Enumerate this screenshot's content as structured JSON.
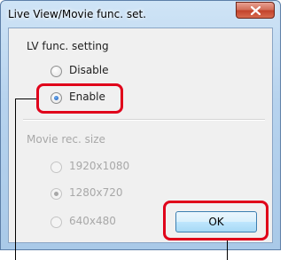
{
  "dialog": {
    "title": "Live View/Movie func. set.",
    "close_icon": "close-icon"
  },
  "lv_group": {
    "heading": "LV func. setting",
    "options": [
      {
        "label": "Disable",
        "selected": false,
        "enabled": true
      },
      {
        "label": "Enable",
        "selected": true,
        "enabled": true
      }
    ]
  },
  "movie_group": {
    "heading": "Movie rec. size",
    "enabled": false,
    "options": [
      {
        "label": "1920x1080",
        "selected": false
      },
      {
        "label": "1280x720",
        "selected": true
      },
      {
        "label": "640x480",
        "selected": false
      }
    ]
  },
  "buttons": {
    "ok_label": "OK"
  },
  "colors": {
    "highlight": "#e0001a",
    "window_frame": "#a9c9e8",
    "client_bg": "#f0f0f0"
  }
}
